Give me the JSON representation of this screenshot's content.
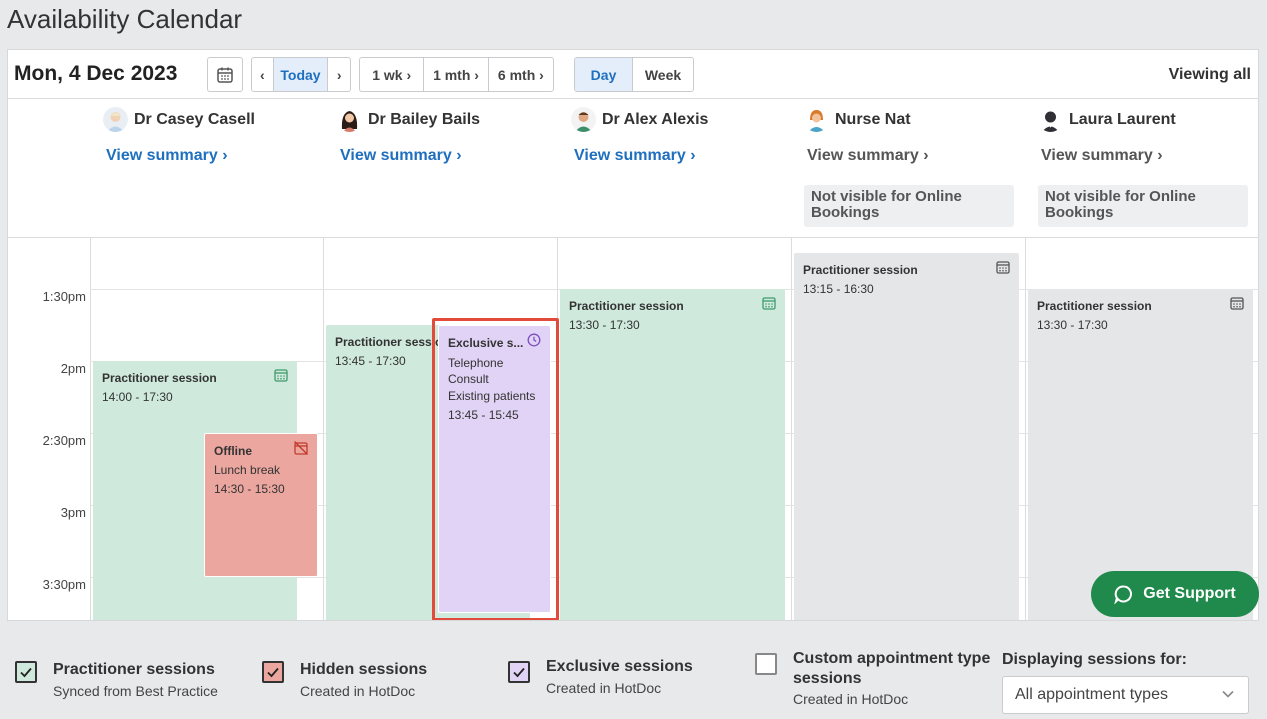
{
  "page": {
    "title": "Availability Calendar"
  },
  "toolbar": {
    "date": "Mon, 4 Dec 2023",
    "prev": "‹",
    "today": "Today",
    "next": "›",
    "range": [
      "1 wk ›",
      "1 mth ›",
      "6 mth ›"
    ],
    "views": [
      "Day",
      "Week"
    ],
    "active_view": "Day",
    "viewing": "Viewing all"
  },
  "practitioners": [
    {
      "name": "Dr Casey Casell",
      "summary": "View summary ›",
      "link_color": "#1f6fbf",
      "note": ""
    },
    {
      "name": "Dr Bailey Bails",
      "summary": "View summary ›",
      "link_color": "#1f6fbf",
      "note": ""
    },
    {
      "name": "Dr Alex Alexis",
      "summary": "View summary ›",
      "link_color": "#1f6fbf",
      "note": ""
    },
    {
      "name": "Nurse Nat",
      "summary": "View summary ›",
      "link_color": "#555555",
      "note": "Not visible for Online Bookings"
    },
    {
      "name": "Laura Laurent",
      "summary": "View summary ›",
      "link_color": "#555555",
      "note": "Not visible for Online Bookings"
    }
  ],
  "time_labels": [
    "1:30pm",
    "2pm",
    "2:30pm",
    "3pm",
    "3:30pm"
  ],
  "sessions": {
    "casey_practitioner": {
      "title": "Practitioner session",
      "time": "14:00 - 17:30"
    },
    "casey_offline": {
      "title": "Offline",
      "detail": "Lunch break",
      "time": "14:30 - 15:30"
    },
    "bailey_practitioner": {
      "title": "Practitioner session",
      "time": "13:45 - 17:30"
    },
    "bailey_exclusive": {
      "title": "Exclusive s...",
      "detail1": "Telephone Consult",
      "detail2": "Existing patients",
      "time": "13:45 - 15:45"
    },
    "alex_practitioner": {
      "title": "Practitioner session",
      "time": "13:30 - 17:30"
    },
    "nat_practitioner": {
      "title": "Practitioner session",
      "time": "13:15 - 16:30"
    },
    "laura_practitioner": {
      "title": "Practitioner session",
      "time": "13:30 - 17:30"
    }
  },
  "support": {
    "label": "Get Support"
  },
  "legend": [
    {
      "title": "Practitioner sessions",
      "sub": "Synced from Best Practice",
      "checked": true,
      "color": "#cfe9dc"
    },
    {
      "title": "Hidden sessions",
      "sub": "Created in HotDoc",
      "checked": true,
      "color": "#eaa69f"
    },
    {
      "title": "Exclusive sessions",
      "sub": "Created in HotDoc",
      "checked": true,
      "color": "#e1d3f5"
    },
    {
      "title": "Custom appointment type sessions",
      "sub": "Created in HotDoc",
      "checked": false,
      "color": "#ffffff"
    }
  ],
  "filter": {
    "label": "Displaying sessions for:",
    "value": "All appointment types"
  }
}
